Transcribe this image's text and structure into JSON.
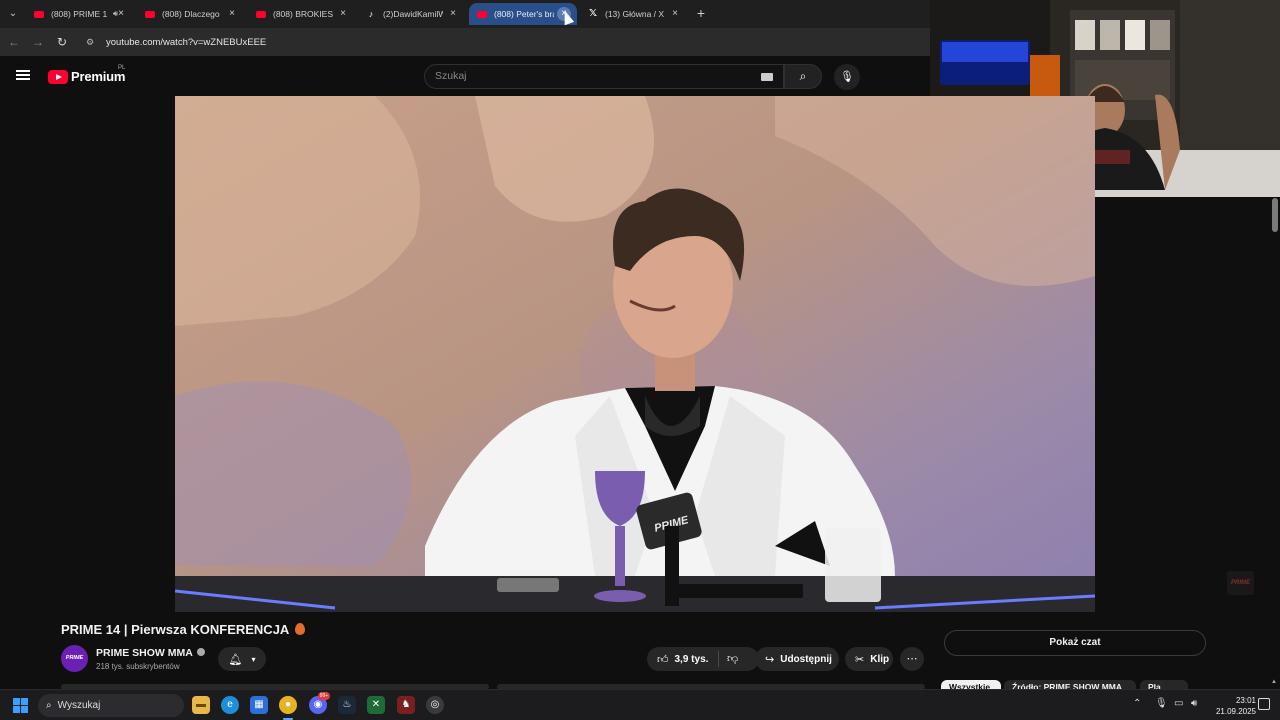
{
  "browser": {
    "tabs": [
      {
        "title": "(808) PRIME 1",
        "icon": "youtube-favicon",
        "audio": true,
        "active": false
      },
      {
        "title": "(808) Dlaczego Te",
        "icon": "youtube-favicon",
        "active": false
      },
      {
        "title": "(808) BROKIES VS",
        "icon": "youtube-favicon",
        "active": false
      },
      {
        "title": "(2)DawidKamilWu",
        "icon": "tiktok-favicon",
        "active": false
      },
      {
        "title": "(808) Peter's brai",
        "icon": "youtube-favicon",
        "active": true
      },
      {
        "title": "(13) Główna / X",
        "icon": "x-favicon",
        "active": false
      }
    ],
    "close_glyph": "×",
    "new_tab_glyph": "+",
    "url": "youtube.com/watch?v=wZNEBUxEEE"
  },
  "youtube": {
    "brand": "Premium",
    "region": "PL",
    "search_placeholder": "Szukaj",
    "video": {
      "title": "PRIME 14 | Pierwsza KONFERENCJA",
      "channel": "PRIME SHOW MMA",
      "channel_avatar_text": "PRIME",
      "subscribers": "218 tys. subskrybentów",
      "likes": "3,9 tys.",
      "share_label": "Udostępnij",
      "clip_label": "Klip",
      "watermark": "PRIME",
      "mic_logo": "PRIME"
    },
    "chat_button": "Pokaż czat",
    "chips": [
      "Wszystkie",
      "Źródło: PRIME SHOW MMA",
      "Pla"
    ]
  },
  "taskbar": {
    "search_placeholder": "Wyszukaj",
    "time": "23:01",
    "date": "21.09.2025",
    "discord_badge": "99+"
  },
  "colors": {
    "youtube_red": "#ff0033",
    "active_tab": "#2a4e8a",
    "background": "#0f0f0f",
    "windows_blue": "#3aa0ff"
  }
}
